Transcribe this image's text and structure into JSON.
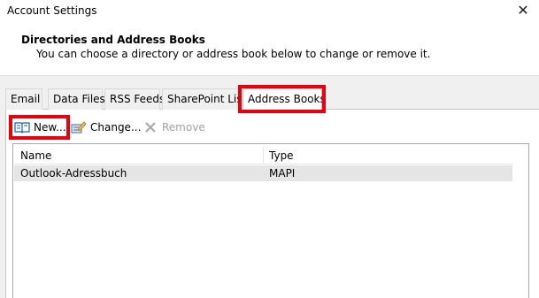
{
  "window": {
    "title": "Account Settings",
    "close_glyph": "✕"
  },
  "header": {
    "title": "Directories and Address Books",
    "description": "You can choose a directory or address book below to change or remove it."
  },
  "tabs": [
    {
      "label": "Email",
      "active": false
    },
    {
      "label": "Data Files",
      "active": false
    },
    {
      "label": "RSS Feeds",
      "active": false
    },
    {
      "label": "SharePoint Lists",
      "active": false
    },
    {
      "label": "Address Books",
      "active": true
    }
  ],
  "toolbar": {
    "new_label": "New...",
    "change_label": "Change...",
    "remove_label": "Remove",
    "new_icon": "address-book-icon",
    "change_icon": "edit-icon",
    "remove_icon": "x-icon"
  },
  "table": {
    "columns": [
      "Name",
      "Type"
    ],
    "rows": [
      {
        "name": "Outlook-Adressbuch",
        "type": "MAPI"
      }
    ]
  },
  "colors": {
    "highlight": "#e8000b",
    "row_selected": "#e5e5e5"
  }
}
